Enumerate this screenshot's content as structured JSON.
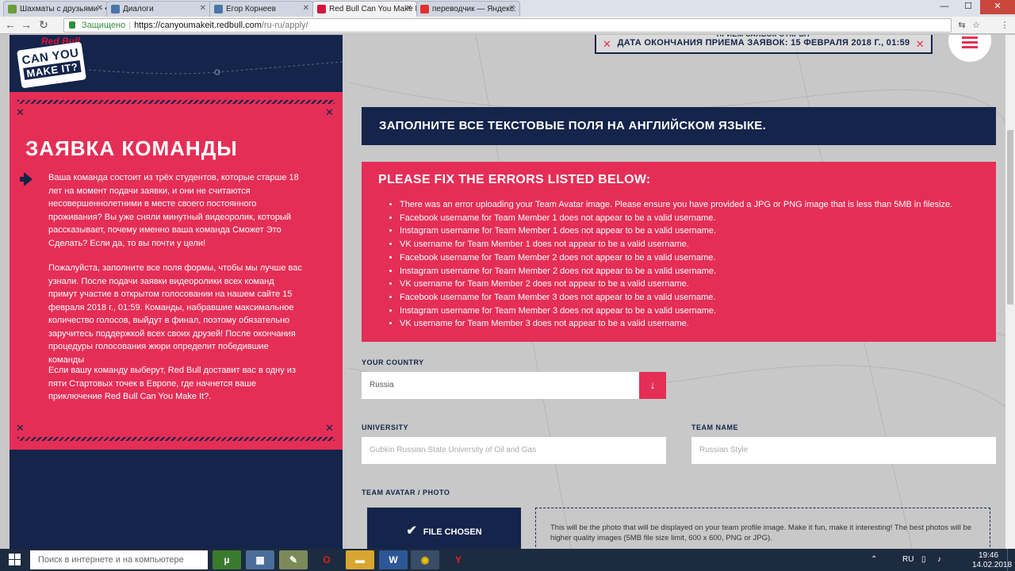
{
  "browser": {
    "tabs": [
      {
        "title": "Шахматы с друзьями - •",
        "favicon_color": "#6a9c3a"
      },
      {
        "title": "Диалоги",
        "favicon_color": "#4a76a8"
      },
      {
        "title": "Егор Корнеев",
        "favicon_color": "#4a76a8"
      },
      {
        "title": "Red Bull Can You Make I",
        "favicon_color": "#d5163c"
      },
      {
        "title": "переводчик — Яндекс:",
        "favicon_color": "#e52e2e"
      }
    ],
    "secure_label": "Защищено",
    "url_host": "https://canyoumakeit.redbull.com",
    "url_path": "/ru-ru/apply/"
  },
  "logo": {
    "brand": "Red Bull",
    "line1": "CAN YOU",
    "line2": "MAKE IT?"
  },
  "deadline": {
    "top_line": "ПРИЕМ ЗАЯВОК ОТКРЫТ",
    "text": "ДАТА ОКОНЧАНИЯ ПРИЕМА ЗАЯВОК: 15 ФЕВРАЛЯ 2018 Г., 01:59"
  },
  "intro": {
    "title": "ЗАЯВКА КОМАНДЫ",
    "p1": "Ваша команда состоит из трёх студентов, которые старше 18 лет на момент подачи заявки, и они не считаются несовершеннолетними в месте своего постоянного проживания? Вы уже сняли минутный видеоролик, который рассказывает, почему именно ваша команда Сможет Это Сделать? Если да, то вы почти у цели!",
    "p2": "Пожалуйста, заполните все поля формы, чтобы мы лучше вас узнали. После подачи заявки видеоролики всех команд примут участие в открытом голосовании на нашем сайте 15 февраля 2018 г., 01:59. Команды, набравшие максимальное количество голосов, выйдут в финал, поэтому обязательно заручитесь поддержкой всех своих друзей! После окончания процедуры голосования жюри определит победившие команды",
    "p3": "Если вашу команду выберут, Red Bull доставит вас в одну из пяти Стартовых точек в Европе, где начнется ваше приключение Red Bull Can You Make It?."
  },
  "form": {
    "banner": "ЗАПОЛНИТЕ ВСЕ ТЕКСТОВЫЕ ПОЛЯ НА АНГЛИЙСКОМ ЯЗЫКЕ.",
    "errors_title": "PLEASE FIX THE ERRORS LISTED BELOW:",
    "errors": [
      "There was an error uploading your Team Avatar image. Please ensure you have provided a JPG or PNG image that is less than 5MB in filesize.",
      "Facebook username for Team Member 1 does not appear to be a valid username.",
      "Instagram username for Team Member 1 does not appear to be a valid username.",
      "VK username for Team Member 1 does not appear to be a valid username.",
      "Facebook username for Team Member 2 does not appear to be a valid username.",
      "Instagram username for Team Member 2 does not appear to be a valid username.",
      "VK username for Team Member 2 does not appear to be a valid username.",
      "Facebook username for Team Member 3 does not appear to be a valid username.",
      "Instagram username for Team Member 3 does not appear to be a valid username.",
      "VK username for Team Member 3 does not appear to be a valid username."
    ],
    "country_label": "YOUR COUNTRY",
    "country_value": "Russia",
    "university_label": "UNIVERSITY",
    "university_placeholder": "Gubkin Russian State University of Oil and Gas",
    "team_name_label": "TEAM NAME",
    "team_name_placeholder": "Russian Style",
    "avatar_label": "TEAM AVATAR / PHOTO",
    "file_button": "FILE CHOSEN",
    "avatar_note": "This will be the photo that will be displayed on your team profile image. Make it fun, make it interesting! The best photos will be higher quality images (5MB file size limit, 600 x 600, PNG or JPG)."
  },
  "taskbar": {
    "search_placeholder": "Поиск в интернете и на компьютере",
    "lang": "RU",
    "time": "19:46",
    "date": "14.02.2018"
  },
  "colors": {
    "navy": "#14244a",
    "pink": "#e52e56"
  }
}
